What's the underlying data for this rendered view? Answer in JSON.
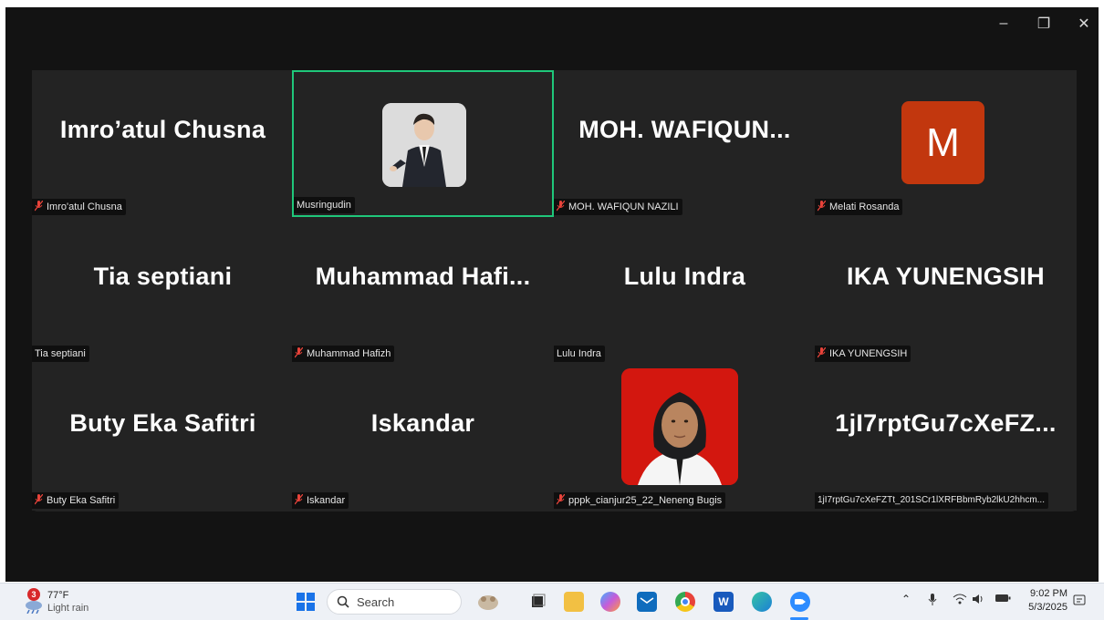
{
  "window": {
    "controls": {
      "minimize": "–",
      "restore": "❐",
      "close": "✕"
    }
  },
  "tiles": [
    {
      "display_name": "Imro’atul Chusna",
      "label": "Imro'atul Chusna",
      "muted": true,
      "avatar": "none"
    },
    {
      "display_name": "",
      "label": "Musringudin",
      "muted": false,
      "avatar": "photo-man-suit",
      "speaking": true
    },
    {
      "display_name": "MOH.  WAFIQUN...",
      "label": "MOH. WAFIQUN NAZILI",
      "muted": true,
      "avatar": "none"
    },
    {
      "display_name": "",
      "label": "Melati Rosanda",
      "muted": true,
      "avatar": "letter",
      "avatar_letter": "M"
    },
    {
      "display_name": "Tia septiani",
      "label": "Tia septiani",
      "muted": false,
      "avatar": "none"
    },
    {
      "display_name": "Muhammad  Hafi...",
      "label": "Muhammad Hafizh",
      "muted": true,
      "avatar": "none"
    },
    {
      "display_name": "Lulu Indra",
      "label": "Lulu Indra",
      "muted": false,
      "avatar": "none"
    },
    {
      "display_name": "IKA YUNENGSIH",
      "label": "IKA YUNENGSIH",
      "muted": true,
      "avatar": "none"
    },
    {
      "display_name": "Buty Eka Safitri",
      "label": "Buty Eka Safitri",
      "muted": true,
      "avatar": "none"
    },
    {
      "display_name": "Iskandar",
      "label": "Iskandar",
      "muted": true,
      "avatar": "none"
    },
    {
      "display_name": "",
      "label": "pppk_cianjur25_22_Neneng Bugis",
      "muted": true,
      "avatar": "photo-woman-hijab"
    },
    {
      "display_name": "1jI7rptGu7cXeFZ...",
      "label": "1jI7rptGu7cXeFZTt_201SCr1lXRFBbmRyb2lkU2hhcm...",
      "muted": false,
      "avatar": "none"
    }
  ],
  "taskbar": {
    "weather": {
      "badge": "3",
      "temp": "77°F",
      "condition": "Light rain"
    },
    "search_label": "Search",
    "apps": [
      "windows-start-icon",
      "search-icon",
      "widgets-icon",
      "task-view-icon",
      "file-explorer-icon",
      "copilot-icon",
      "mail-icon",
      "chrome-icon",
      "word-icon",
      "edge-icon",
      "zoom-icon"
    ],
    "time": "9:02 PM",
    "date": "5/3/2025"
  },
  "colors": {
    "speaking_border": "#1fc77a",
    "muted_icon": "#e8433a",
    "avatar_m_bg": "#c2370e",
    "zoom_blue": "#2d8cff"
  }
}
